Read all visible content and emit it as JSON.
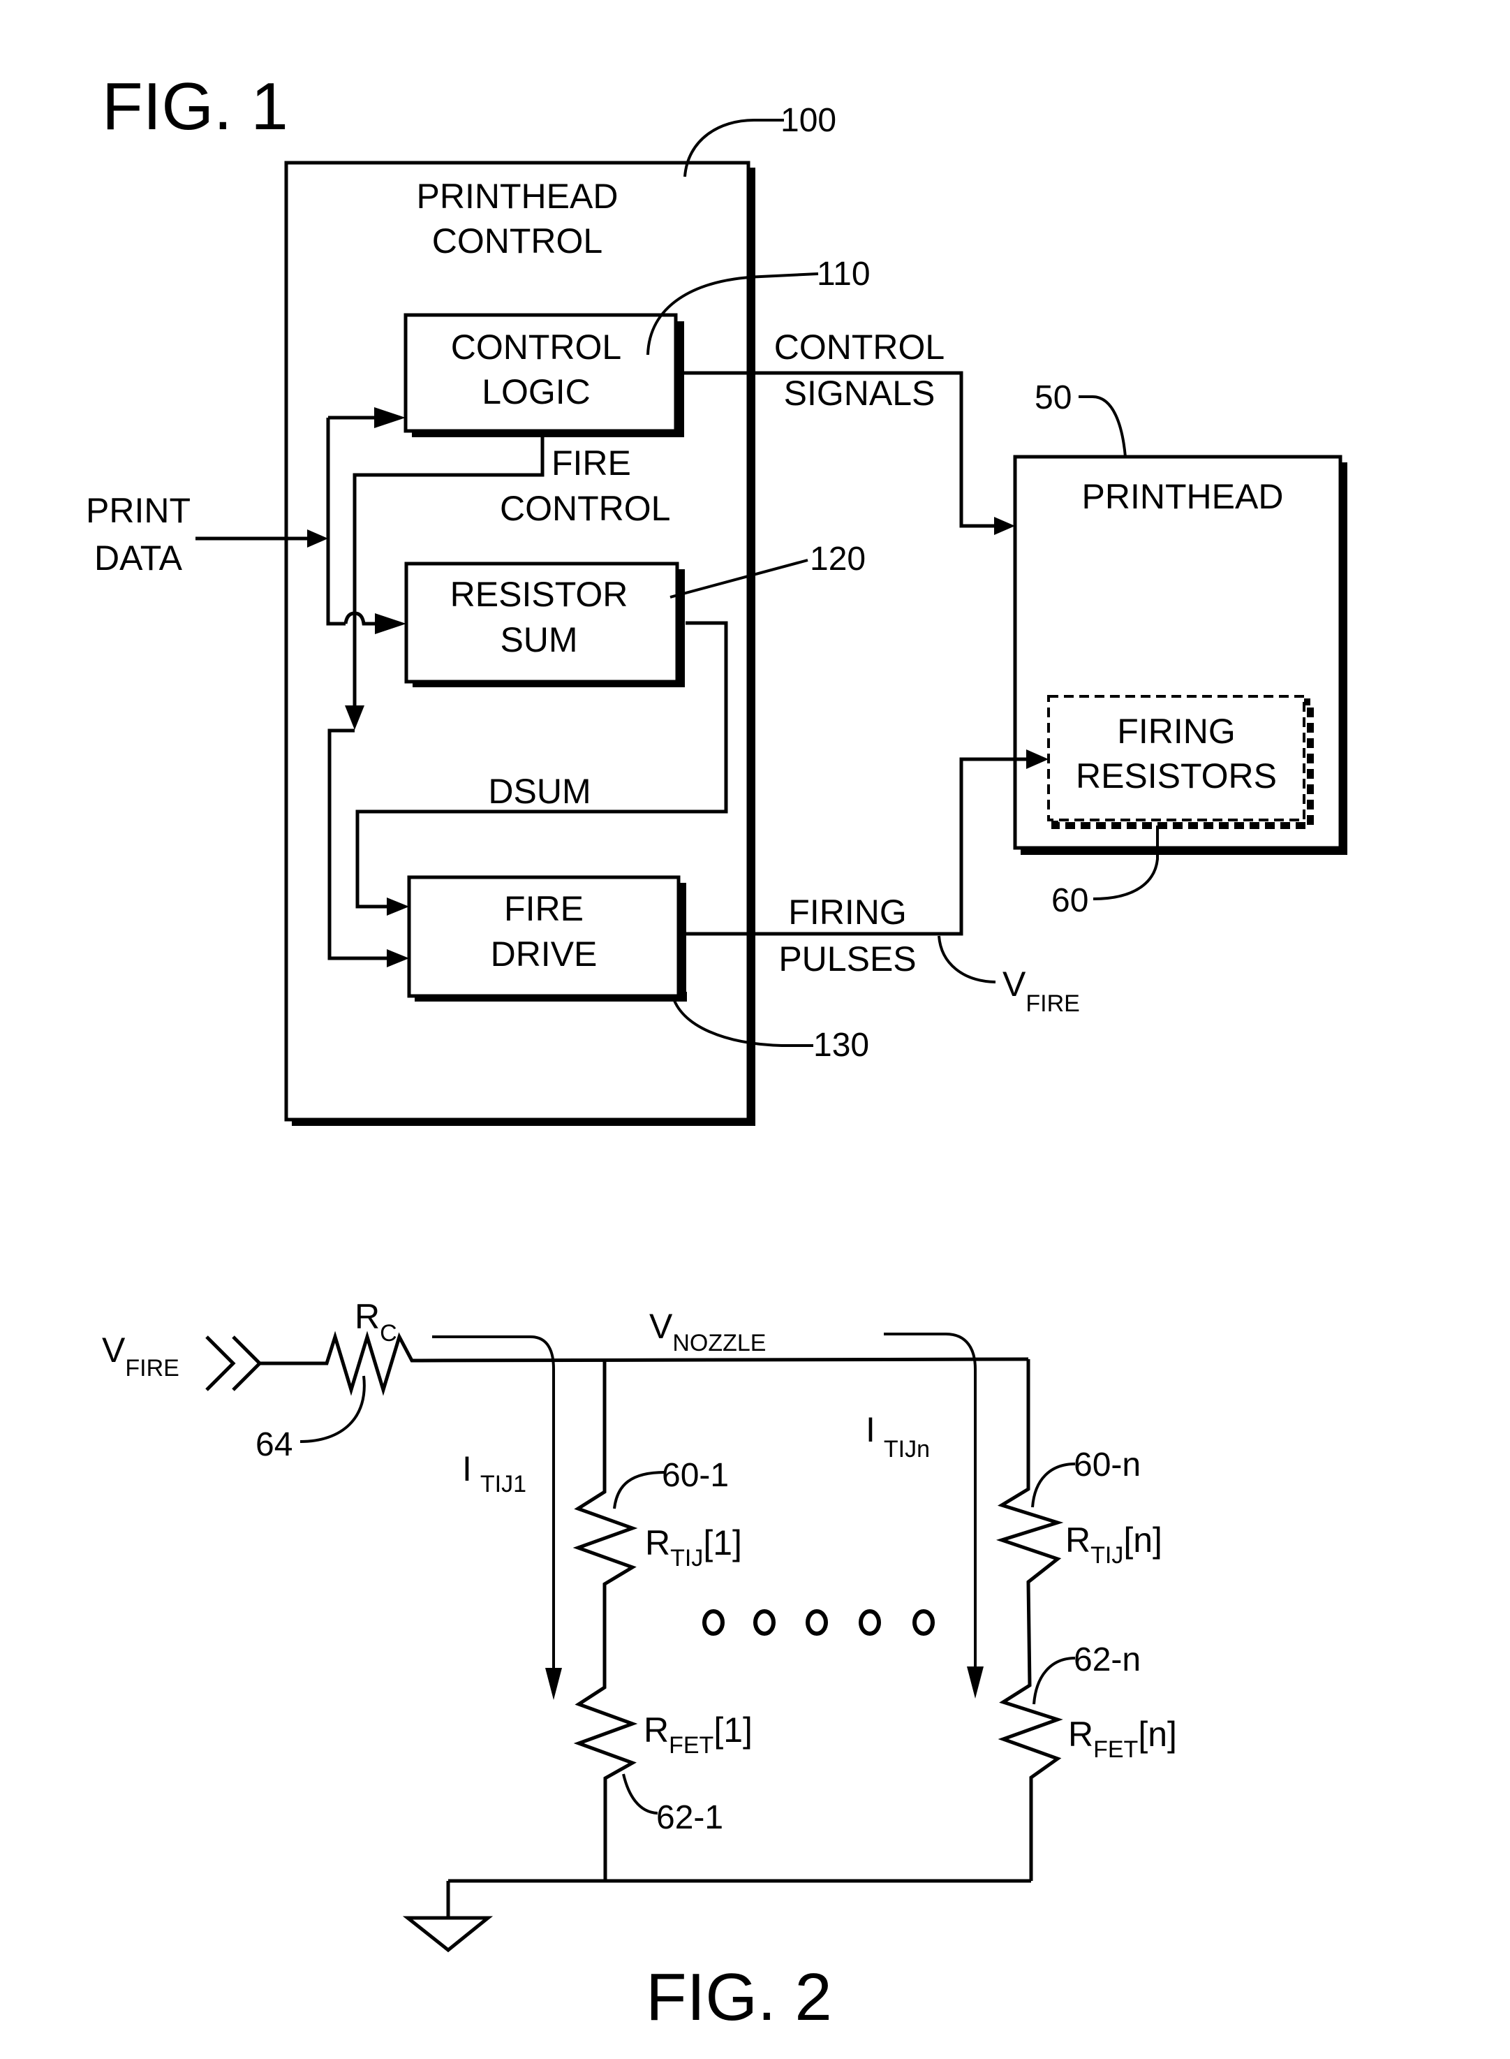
{
  "fig1": {
    "title": "FIG. 1",
    "printhead_control": {
      "label_line1": "PRINTHEAD",
      "label_line2": "CONTROL",
      "ref": "100"
    },
    "control_logic": {
      "line1": "CONTROL",
      "line2": "LOGIC",
      "ref": "110"
    },
    "resistor_sum": {
      "line1": "RESISTOR",
      "line2": "SUM",
      "ref": "120"
    },
    "fire_drive": {
      "line1": "FIRE",
      "line2": "DRIVE",
      "ref": "130"
    },
    "printhead": {
      "label": "PRINTHEAD",
      "ref": "50"
    },
    "firing_resistors": {
      "line1": "FIRING",
      "line2": "RESISTORS",
      "ref": "60"
    },
    "signals": {
      "print_data_line1": "PRINT",
      "print_data_line2": "DATA",
      "fire_control_line1": "FIRE",
      "fire_control_line2": "CONTROL",
      "dsum": "DSUM",
      "control_signals_line1": "CONTROL",
      "control_signals_line2": "SIGNALS",
      "firing_pulses_line1": "FIRING",
      "firing_pulses_line2": "PULSES",
      "vfire_main": "V",
      "vfire_sub": "FIRE"
    }
  },
  "fig2": {
    "title": "FIG. 2",
    "vfire_main": "V",
    "vfire_sub": "FIRE",
    "rc_main": "R",
    "rc_sub": "C",
    "rc_ref": "64",
    "vnozzle_main": "V",
    "vnozzle_sub": "NOZZLE",
    "branch1": {
      "current_main": "I",
      "current_sub": "TIJ1",
      "rtij_main": "R",
      "rtij_sub": "TIJ",
      "rtij_index": "[1]",
      "rtij_ref": "60-1",
      "rfet_main": "R",
      "rfet_sub": "FET",
      "rfet_index": "[1]",
      "rfet_ref": "62-1"
    },
    "branchn": {
      "current_main": "I",
      "current_sub": "TIJn",
      "rtij_main": "R",
      "rtij_sub": "TIJ",
      "rtij_index": "[n]",
      "rtij_ref": "60-n",
      "rfet_main": "R",
      "rfet_sub": "FET",
      "rfet_index": "[n]",
      "rfet_ref": "62-n"
    },
    "ellipsis_count": 5
  }
}
